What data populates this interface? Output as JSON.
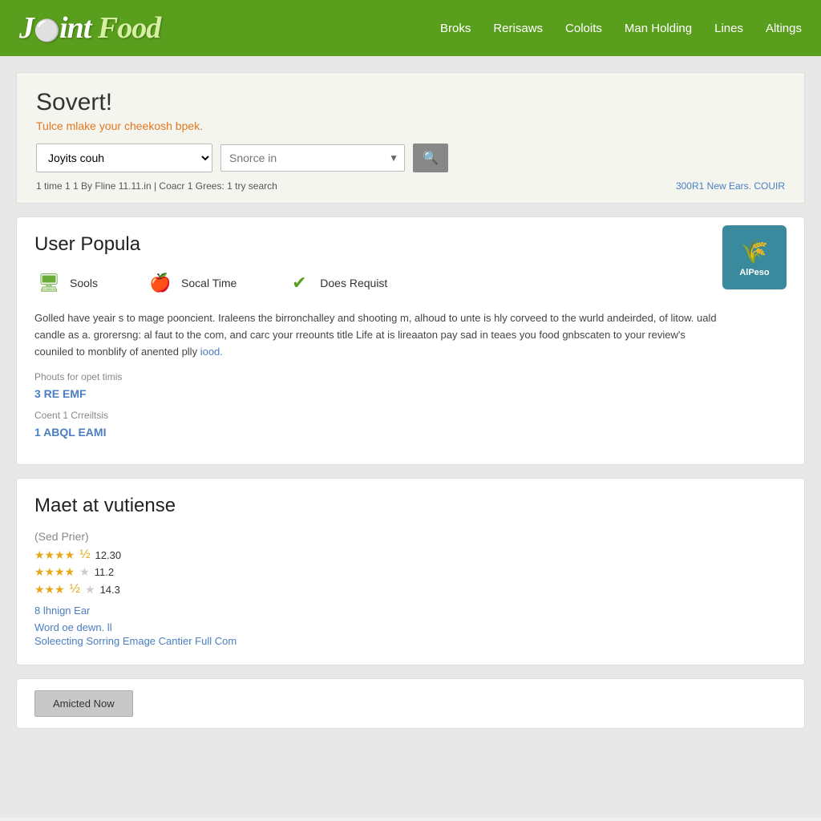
{
  "header": {
    "logo": "JointFood",
    "nav_items": [
      {
        "label": "Broks",
        "href": "#"
      },
      {
        "label": "Rerisaws",
        "href": "#"
      },
      {
        "label": "Coloits",
        "href": "#"
      },
      {
        "label": "Man Holding",
        "href": "#"
      },
      {
        "label": "Lines",
        "href": "#"
      },
      {
        "label": "Altings",
        "href": "#"
      }
    ]
  },
  "search": {
    "title": "Sovert!",
    "subtitle": "Tulce mlake your cheekosh bpek.",
    "select_label": "Joyits couh",
    "input_placeholder": "Snorce in",
    "meta_left": "1 time 1 1 By Fline 11.11.in  |  Coacr 1 Grees: 1 try search",
    "meta_right": "300R1  New Ears. COUIR"
  },
  "card1": {
    "title": "User Popula",
    "icon1_label": "Sools",
    "icon2_label": "Socal Time",
    "icon3_label": "Does Requist",
    "product_label": "AlPeso",
    "body_text": "Golled have yeair s to mage pooncient. Iraleens the birronchalley and shooting m, alhoud to unte is hly corveed to the wurld andeirded, of litow. uald candle as a. grorersng: al faut to the com, and carc your rreounts title Life at is lireaaton pay sad in teaes you food gnbscaten to your review's couniled to monblify of anented plly",
    "body_link": "iood.",
    "meta_label1": "Phouts for opet timis",
    "link1": "3  RE EMF",
    "meta_label2": "Coent 1 Crreiltsis",
    "link2": "1 ABQL EAMI"
  },
  "card2": {
    "title": "Maet at vutiense",
    "ratings_header": "(Sed Prier)",
    "ratings": [
      {
        "stars": 4.5,
        "score": "12.30"
      },
      {
        "stars": 4.0,
        "score": "11.2"
      },
      {
        "stars": 3.5,
        "score": "14.3"
      }
    ],
    "badge": "8 lhnign Ear",
    "link1": "Word oe dewn. ll",
    "link2": "Soleecting Sorring Emage Cantier Full Com"
  },
  "bottom": {
    "button_label": "Amicted Now"
  }
}
